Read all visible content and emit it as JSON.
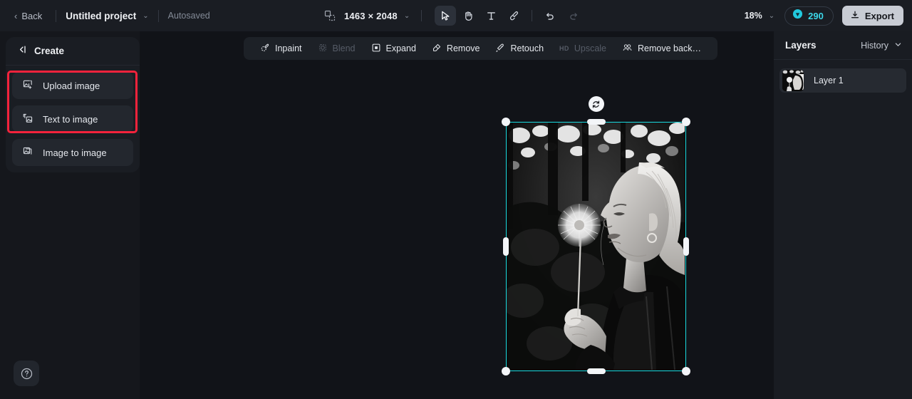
{
  "header": {
    "back_label": "Back",
    "project_title": "Untitled project",
    "project_caret": "⌄",
    "autosaved_label": "Autosaved",
    "canvas_size": "1463 × 2048",
    "canvas_size_caret": "⌄",
    "zoom_level": "18%",
    "zoom_caret": "⌄",
    "credits": "290",
    "export_label": "Export",
    "tools": [
      {
        "name": "select-tool",
        "active": true
      },
      {
        "name": "hand-tool",
        "active": false
      },
      {
        "name": "text-tool",
        "active": false
      },
      {
        "name": "brush-tool",
        "active": false
      },
      {
        "name": "undo-tool",
        "active": false
      },
      {
        "name": "redo-tool",
        "active": false
      }
    ]
  },
  "sidebar": {
    "title": "Create",
    "collapse_icon": "collapse-left-icon",
    "items": [
      {
        "label": "Upload image",
        "icon": "upload-image-icon"
      },
      {
        "label": "Text to image",
        "icon": "text-to-image-icon"
      },
      {
        "label": "Image to image",
        "icon": "image-to-image-icon"
      }
    ],
    "help_label": "?"
  },
  "annotation": {
    "color": "#f4233c",
    "highlights": [
      "Upload image",
      "Text to image"
    ]
  },
  "canvas_toolbar": {
    "items": [
      {
        "label": "Inpaint",
        "icon": "inpaint-icon",
        "disabled": false
      },
      {
        "label": "Blend",
        "icon": "blend-icon",
        "disabled": true
      },
      {
        "label": "Expand",
        "icon": "expand-icon",
        "disabled": false
      },
      {
        "label": "Remove",
        "icon": "remove-icon",
        "disabled": false
      },
      {
        "label": "Retouch",
        "icon": "retouch-icon",
        "disabled": false
      },
      {
        "label": "Upscale",
        "icon": "upscale-icon",
        "badge": "HD",
        "disabled": true
      },
      {
        "label": "Remove back…",
        "icon": "remove-background-icon",
        "disabled": false
      }
    ]
  },
  "canvas": {
    "selection_color": "#19dbe0",
    "rotate_handle": "rotate-icon",
    "image_description": "Black and white photograph of a woman in profile blowing a dandelion seed head in a forest"
  },
  "right_panel": {
    "title": "Layers",
    "history_label": "History",
    "history_caret": "⌄",
    "layers": [
      {
        "name": "Layer 1"
      }
    ]
  }
}
